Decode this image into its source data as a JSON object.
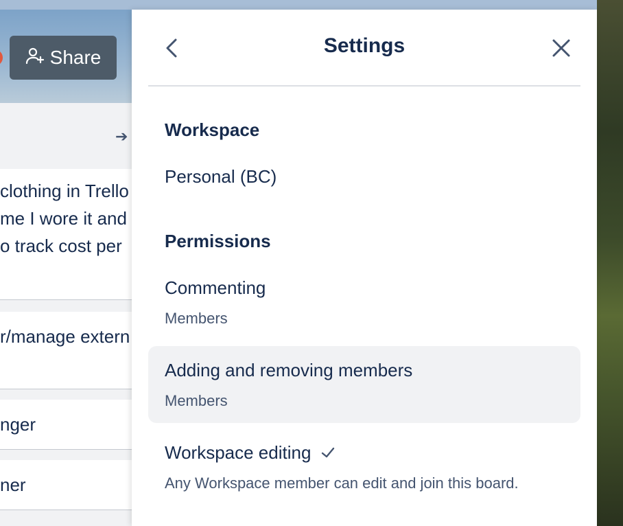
{
  "board": {
    "share_label": "Share",
    "cards": [
      {
        "lines": [
          "clothing in Trello",
          "me I wore it and",
          "o track cost per"
        ]
      },
      {
        "lines": [
          "r/manage extern"
        ]
      },
      {
        "lines": [
          "nger"
        ]
      },
      {
        "lines": [
          "ner"
        ]
      }
    ]
  },
  "panel": {
    "title": "Settings",
    "workspace_heading": "Workspace",
    "workspace_value": "Personal (BC)",
    "permissions_heading": "Permissions",
    "items": [
      {
        "title": "Commenting",
        "value": "Members"
      },
      {
        "title": "Adding and removing members",
        "value": "Members"
      },
      {
        "title": "Workspace editing",
        "value": "Any Workspace member can edit and join this board."
      }
    ]
  },
  "colors": {
    "text": "#172b4d",
    "subtext": "#44546f",
    "hover_bg": "#f1f2f4",
    "share_bg": "#4d5b68"
  }
}
